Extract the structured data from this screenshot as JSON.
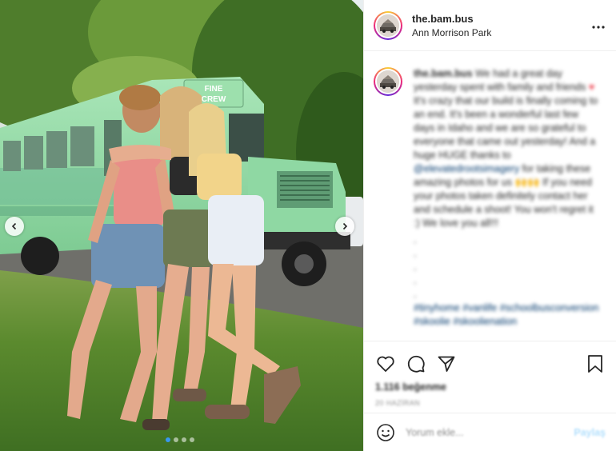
{
  "post": {
    "username": "the.bam.bus",
    "location": "Ann Morrison Park",
    "more_icon": "ellipsis-icon",
    "bus_sign": [
      "FINE",
      "CREW"
    ]
  },
  "caption": {
    "username": "the.bam.bus",
    "part1": "We had a great day yesterday spent with family and friends ",
    "heart": "♥",
    "part2": " It's crazy that our build is finally coming to an end. It's been a wonderful last few days in Idaho and we are so grateful to everyone that came out yesterday! And a huge HUGE thanks to ",
    "mention": "@elevatedrootsimagery",
    "part3": " for taking these amazing photos for us 🙌🙌 If you need your photos taken definitely contact her and schedule a shoot! You won't regret it :) We love you all!!!",
    "dots": [
      ".",
      ".",
      ".",
      ".",
      "."
    ],
    "tags": "#tinyhome #vanlife #schoolbusconversion #skoolie #skoolienation"
  },
  "engagement": {
    "likes": "1.116 beğenme",
    "time": "20 HAZİRAN"
  },
  "comment_input": {
    "placeholder": "Yorum ekle...",
    "post_label": "Paylaş"
  },
  "carousel": {
    "slide_count": 4,
    "active_index": 0
  },
  "colors": {
    "bus_green": "#8fd8a3",
    "link_blue": "#00376b",
    "post_button": "#b2dffc",
    "active_dot": "#3897f0"
  }
}
